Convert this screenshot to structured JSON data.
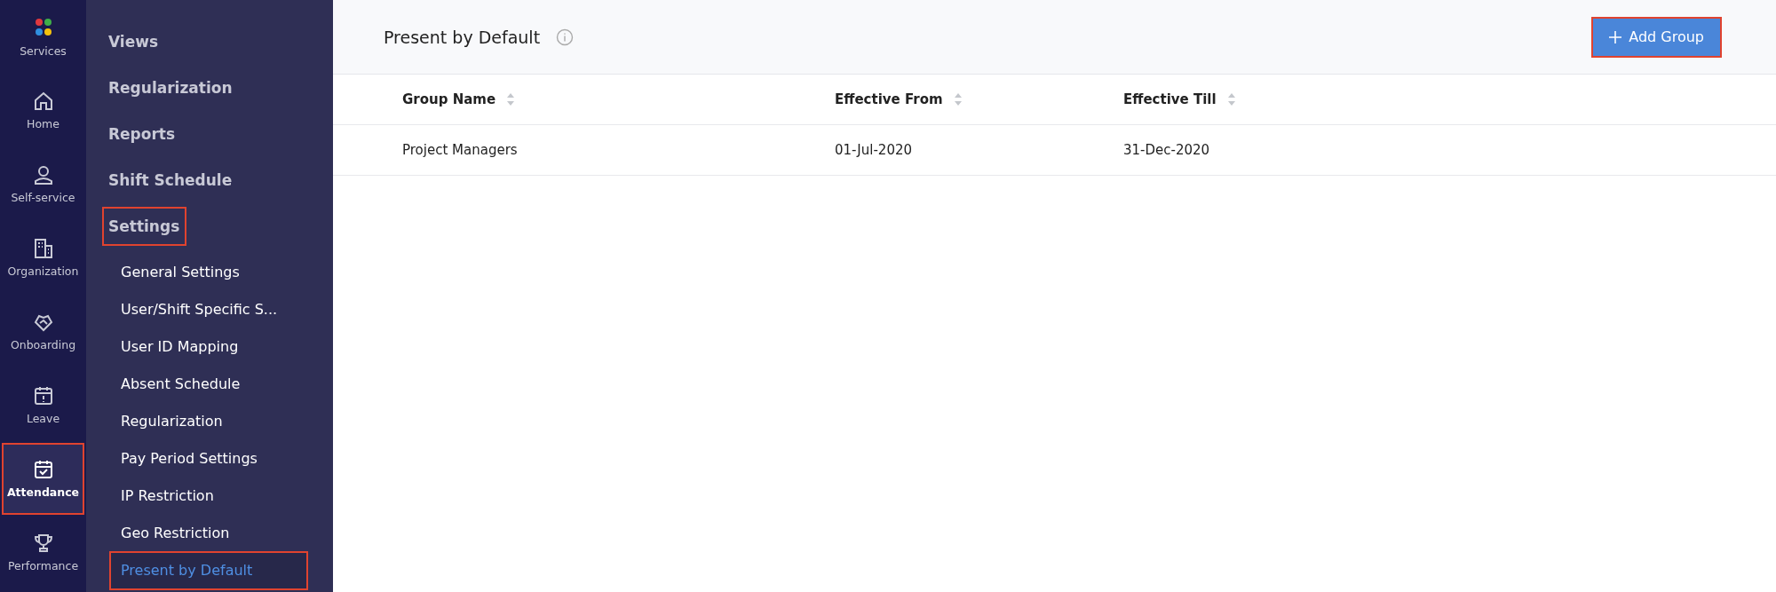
{
  "rail": [
    {
      "label": "Services",
      "selected": false,
      "highlighted": false
    },
    {
      "label": "Home",
      "selected": false,
      "highlighted": false
    },
    {
      "label": "Self-service",
      "selected": false,
      "highlighted": false
    },
    {
      "label": "Organization",
      "selected": false,
      "highlighted": false
    },
    {
      "label": "Onboarding",
      "selected": false,
      "highlighted": false
    },
    {
      "label": "Leave",
      "selected": false,
      "highlighted": false
    },
    {
      "label": "Attendance",
      "selected": true,
      "highlighted": true
    },
    {
      "label": "Performance",
      "selected": false,
      "highlighted": false
    }
  ],
  "sidebar": {
    "items": [
      {
        "label": "Views",
        "selected": false,
        "highlighted": false
      },
      {
        "label": "Regularization",
        "selected": false,
        "highlighted": false
      },
      {
        "label": "Reports",
        "selected": false,
        "highlighted": false
      },
      {
        "label": "Shift Schedule",
        "selected": false,
        "highlighted": false
      },
      {
        "label": "Settings",
        "selected": false,
        "highlighted": true,
        "children": [
          {
            "label": "General Settings",
            "selected": false,
            "highlighted": false
          },
          {
            "label": "User/Shift Specific S...",
            "selected": false,
            "highlighted": false
          },
          {
            "label": "User ID Mapping",
            "selected": false,
            "highlighted": false
          },
          {
            "label": "Absent Schedule",
            "selected": false,
            "highlighted": false
          },
          {
            "label": "Regularization",
            "selected": false,
            "highlighted": false
          },
          {
            "label": "Pay Period Settings",
            "selected": false,
            "highlighted": false
          },
          {
            "label": "IP Restriction",
            "selected": false,
            "highlighted": false
          },
          {
            "label": "Geo Restriction",
            "selected": false,
            "highlighted": false
          },
          {
            "label": "Present by Default",
            "selected": true,
            "highlighted": true
          }
        ]
      }
    ]
  },
  "header": {
    "title": "Present by Default",
    "add_button": {
      "label": "Add Group",
      "highlighted": true
    }
  },
  "table": {
    "columns": [
      "Group Name",
      "Effective From",
      "Effective Till"
    ],
    "rows": [
      [
        "Project Managers",
        "01-Jul-2020",
        "31-Dec-2020"
      ]
    ]
  }
}
